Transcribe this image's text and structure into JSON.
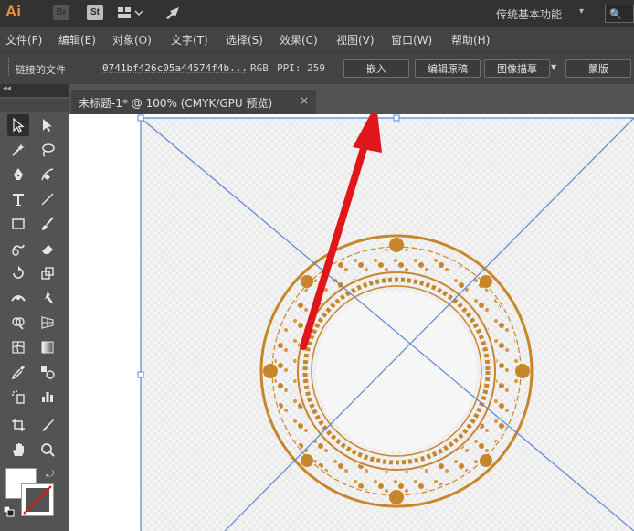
{
  "app": {
    "logo": "Ai",
    "bridge_icon": "Br",
    "stock_icon": "St",
    "workspace": "传统基本功能",
    "search_placeholder": "🔍"
  },
  "menu": [
    "文件(F)",
    "编辑(E)",
    "对象(O)",
    "文字(T)",
    "选择(S)",
    "效果(C)",
    "视图(V)",
    "窗口(W)",
    "帮助(H)"
  ],
  "control_bar": {
    "linked_file_label": "链接的文件",
    "file_name": "0741bf426c05a44574f4b...",
    "color_mode": "RGB",
    "ppi": "PPI: 259",
    "embed_button": "嵌入",
    "edit_original_button": "编辑原稿",
    "image_trace_button": "图像描摹",
    "mask_button": "蒙版"
  },
  "document": {
    "tab_title": "未标题-1* @ 100% (CMYK/GPU 预览)",
    "close": "×"
  },
  "toolbar": {
    "tools": [
      "selection-tool",
      "direct-selection-tool",
      "magic-wand-tool",
      "lasso-tool",
      "pen-tool",
      "curvature-tool",
      "type-tool",
      "line-segment-tool",
      "rectangle-tool",
      "paintbrush-tool",
      "shaper-tool",
      "eraser-tool",
      "rotate-tool",
      "scale-tool",
      "width-tool",
      "puppet-warp-tool",
      "shape-builder-tool",
      "perspective-grid-tool",
      "mesh-tool",
      "gradient-tool",
      "eyedropper-tool",
      "blend-tool",
      "symbol-sprayer-tool",
      "column-graph-tool",
      "artboard-tool",
      "slice-tool",
      "hand-tool",
      "zoom-tool"
    ]
  },
  "colors": {
    "ornament": "#c8862a",
    "guide_lines": "#5a86d6",
    "arrow": "#e0161a"
  }
}
